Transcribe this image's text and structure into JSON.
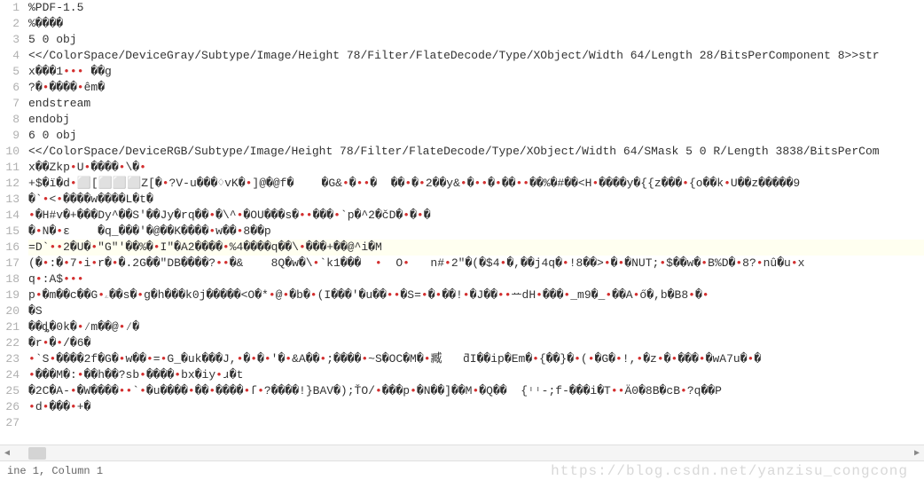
{
  "watermark": "https://blog.csdn.net/yanzisu_congcong",
  "status": {
    "position": "ine 1, Column 1"
  },
  "lines": [
    {
      "num": "1",
      "content": "%PDF-1.5",
      "highlight": false
    },
    {
      "num": "2",
      "content": "%����",
      "highlight": false
    },
    {
      "num": "3",
      "content": "5 0 obj",
      "highlight": false
    },
    {
      "num": "4",
      "content": "<</ColorSpace/DeviceGray/Subtype/Image/Height 78/Filter/FlateDecode/Type/XObject/Width 64/Length 28/BitsPerComponent 8>>str",
      "highlight": false
    },
    {
      "num": "5",
      "content": "x���1••• ��g",
      "highlight": false,
      "hasRed": true
    },
    {
      "num": "6",
      "content": "?�•����•êm�",
      "highlight": false,
      "hasRed": true
    },
    {
      "num": "7",
      "content": "endstream",
      "highlight": false
    },
    {
      "num": "8",
      "content": "endobj",
      "highlight": false
    },
    {
      "num": "9",
      "content": "6 0 obj",
      "highlight": false
    },
    {
      "num": "10",
      "content": "<</ColorSpace/DeviceRGB/Subtype/Image/Height 78/Filter/FlateDecode/Type/XObject/Width 64/SMask 5 0 R/Length 3838/BitsPerCom",
      "highlight": false
    },
    {
      "num": "11",
      "content": "x��Zkp•U•����•\\�•",
      "highlight": false,
      "hasRed": true
    },
    {
      "num": "12",
      "content": "+$�ï�d•⬜[⬜⬜⬜Z[�•?V-u���♢vK�•]@�@f�    �G&•�••�  ��•�•2��y&•�••�•��••��%�#��<H•����y�{{z���•{o��k•U��z�����9",
      "highlight": false,
      "hasRed": true
    },
    {
      "num": "13",
      "content": "�`•<•����w����L�t�",
      "highlight": false,
      "hasRed": true
    },
    {
      "num": "14",
      "content": "•�H#v�+���Dy^��S'��Jy�rq��•�\\^•�OU���s�••���•`p�^2�čD�•�•�",
      "highlight": false,
      "hasRed": true
    },
    {
      "num": "15",
      "content": "�•N�•ε    �q_���'�@��K����•w��•8��p",
      "highlight": false,
      "hasRed": true
    },
    {
      "num": "16",
      "content": "=D`••2�U�•\"G\"'��%�•I\"�A2����•%4����q��\\•���+��@^i�M",
      "highlight": true,
      "hasRed": true
    },
    {
      "num": "17",
      "content": "(�•:�•7•i•r�•�.2G��\"DB����?••�&    8Q�w�\\•`k1���  •  O•   n#•2\"�(�$4•�,��j4q�•!8��>•�•�NUT;•$��w�•B%D�•8?•nû�u•x",
      "highlight": false,
      "hasRed": true
    },
    {
      "num": "18",
      "content": "q•:A$•••",
      "highlight": false,
      "hasRed": true
    },
    {
      "num": "19",
      "content": "p•�m��c��G•ۦ��s�•g�h���k0j�����<O�*•@•�b�•(I���'�u��••�S=•�•��!•�J��••ᅭdH•���•_m9�_•��A•ő�,b�B8•�•",
      "highlight": false,
      "hasRed": true
    },
    {
      "num": "20",
      "content": "�S",
      "highlight": false
    },
    {
      "num": "21",
      "content": "��ȡ�0k�•⁄m��@•⁄�",
      "highlight": false,
      "hasRed": true
    },
    {
      "num": "22",
      "content": "�r•�•/�6�",
      "highlight": false,
      "hasRed": true
    },
    {
      "num": "23",
      "content": "•`S•����2f�G�•w��•=•G_�uk���J,•�•�•'�•&A��•;����•~S�OC�M�•臧   ƌI��ip�Em�•{��}�•(•�G�•!,•�z•�•���•�wA7u�•�",
      "highlight": false,
      "hasRed": true
    },
    {
      "num": "24",
      "content": "•���M�:•��h��?sb•����•bx�iy•ɹ�t",
      "highlight": false,
      "hasRed": true
    },
    {
      "num": "25",
      "content": "�2C�A-•�W����••`•�u����•��•����•ſ•?����!}BAV�);ŤO/•���p•�N��]��M•�Q��  {ᶦᶥ-;f-���i�T••Ä0�8B�cB•?q��P",
      "highlight": false,
      "hasRed": true
    },
    {
      "num": "26",
      "content": "•d•���•+�",
      "highlight": false,
      "hasRed": true
    },
    {
      "num": "27",
      "content": "",
      "highlight": false
    }
  ]
}
